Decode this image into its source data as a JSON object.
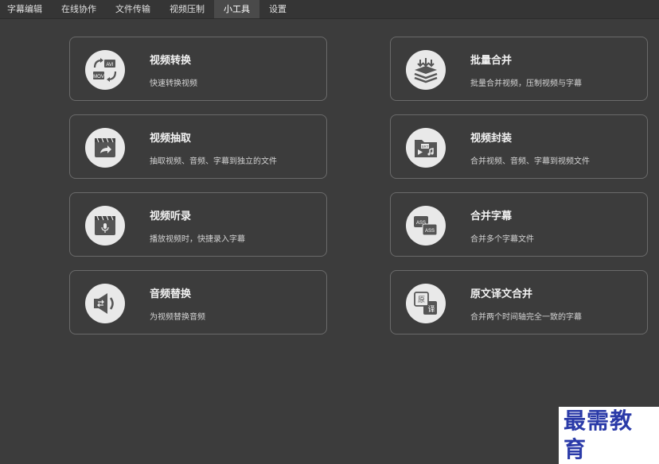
{
  "menu": {
    "tabs": [
      "字幕编辑",
      "在线协作",
      "文件传输",
      "视频压制",
      "小工具",
      "设置"
    ],
    "active_tab": "小工具"
  },
  "cards": [
    {
      "title": "视频转换",
      "desc": "快速转换视频",
      "icon": "video-convert-icon",
      "icon_labels": [
        "AVI",
        "MOV"
      ]
    },
    {
      "title": "批量合并",
      "desc": "批量合并视频，压制视频与字幕",
      "icon": "batch-merge-icon"
    },
    {
      "title": "视频抽取",
      "desc": "抽取视频、音频、字幕到独立的文件",
      "icon": "video-extract-icon"
    },
    {
      "title": "视频封装",
      "desc": "合并视频、音频、字幕到视频文件",
      "icon": "video-package-icon",
      "icon_labels": [
        "SRT"
      ]
    },
    {
      "title": "视频听录",
      "desc": "播放视频时，快捷录入字幕",
      "icon": "video-transcribe-icon"
    },
    {
      "title": "合并字幕",
      "desc": "合并多个字幕文件",
      "icon": "merge-subtitles-icon",
      "icon_labels": [
        "ASS",
        "ASS"
      ]
    },
    {
      "title": "音频替换",
      "desc": "为视频替换音频",
      "icon": "audio-replace-icon"
    },
    {
      "title": "原文译文合并",
      "desc": "合并两个时间轴完全一致的字幕",
      "icon": "translation-merge-icon",
      "icon_labels": [
        "原",
        "译"
      ]
    }
  ],
  "watermark": "最需教育"
}
